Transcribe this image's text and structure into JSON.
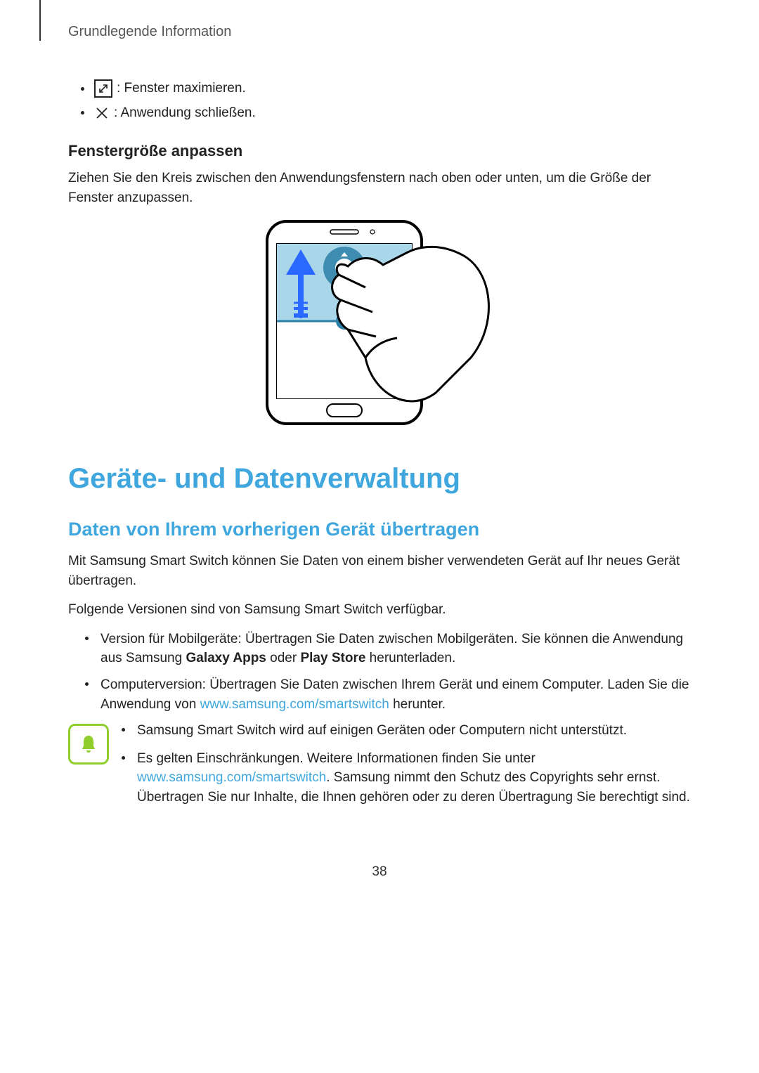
{
  "header": "Grundlegende Information",
  "icons": {
    "maximize": ": Fenster maximieren.",
    "close": ": Anwendung schließen."
  },
  "resize": {
    "heading": "Fenstergröße anpassen",
    "text": "Ziehen Sie den Kreis zwischen den Anwendungsfenstern nach oben oder unten, um die Größe der Fenster anzupassen."
  },
  "h1": "Geräte- und Datenverwaltung",
  "h2": "Daten von Ihrem vorherigen Gerät übertragen",
  "p1": "Mit Samsung Smart Switch können Sie Daten von einem bisher verwendeten Gerät auf Ihr neues Gerät übertragen.",
  "p2": "Folgende Versionen sind von Samsung Smart Switch verfügbar.",
  "bullets": {
    "b1_pre": "Version für Mobilgeräte: Übertragen Sie Daten zwischen Mobilgeräten. Sie können die Anwendung aus Samsung ",
    "b1_bold1": "Galaxy Apps",
    "b1_mid": " oder ",
    "b1_bold2": "Play Store",
    "b1_post": " herunterladen.",
    "b2_pre": "Computerversion: Übertragen Sie Daten zwischen Ihrem Gerät und einem Computer. Laden Sie die Anwendung von ",
    "b2_link": "www.samsung.com/smartswitch",
    "b2_post": " herunter."
  },
  "note": {
    "n1": "Samsung Smart Switch wird auf einigen Geräten oder Computern nicht unterstützt.",
    "n2_pre": "Es gelten Einschränkungen. Weitere Informationen finden Sie unter ",
    "n2_link": "www.samsung.com/smartswitch",
    "n2_post": ". Samsung nimmt den Schutz des Copyrights sehr ernst. Übertragen Sie nur Inhalte, die Ihnen gehören oder zu deren Übertragung Sie berechtigt sind."
  },
  "page_number": "38"
}
